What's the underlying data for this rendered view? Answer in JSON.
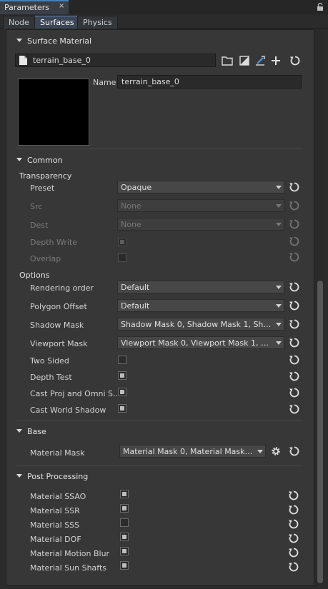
{
  "window": {
    "title": "Parameters",
    "close_glyph": "×"
  },
  "tabs": [
    {
      "label": "Node",
      "active": false
    },
    {
      "label": "Surfaces",
      "active": true
    },
    {
      "label": "Physics",
      "active": false
    }
  ],
  "surface_material": {
    "header": "Surface Material",
    "material_path": "terrain_base_0",
    "name_label": "Name",
    "name_value": "terrain_base_0",
    "toolbar_icons": [
      "folder-icon",
      "inherit-icon",
      "edit-icon",
      "add-icon",
      "reset-icon"
    ]
  },
  "common": {
    "header": "Common",
    "transparency": {
      "label": "Transparency",
      "preset": {
        "label": "Preset",
        "value": "Opaque"
      },
      "src": {
        "label": "Src",
        "value": "None"
      },
      "dest": {
        "label": "Dest",
        "value": "None"
      },
      "depth_write": {
        "label": "Depth Write",
        "checked": true
      },
      "overlap": {
        "label": "Overlap",
        "checked": false
      }
    },
    "options": {
      "label": "Options",
      "rendering_order": {
        "label": "Rendering order",
        "value": "Default"
      },
      "polygon_offset": {
        "label": "Polygon Offset",
        "value": "Default"
      },
      "shadow_mask": {
        "label": "Shadow Mask",
        "value": "Shadow Mask 0, Shadow Mask 1, Shadow ..."
      },
      "viewport_mask": {
        "label": "Viewport Mask",
        "value": "Viewport Mask 0, Viewport Mask 1, Viewpo..."
      },
      "two_sided": {
        "label": "Two Sided",
        "checked": false
      },
      "depth_test": {
        "label": "Depth Test",
        "checked": true
      },
      "cast_proj_omni": {
        "label": "Cast Proj and Omni S...",
        "checked": true
      },
      "cast_world_shadow": {
        "label": "Cast World Shadow",
        "checked": true
      }
    }
  },
  "base": {
    "header": "Base",
    "material_mask": {
      "label": "Material Mask",
      "value": "Material Mask 0, Material Mask 1, Ma..."
    }
  },
  "post_processing": {
    "header": "Post Processing",
    "items": [
      {
        "label": "Material SSAO",
        "checked": true
      },
      {
        "label": "Material SSR",
        "checked": true
      },
      {
        "label": "Material SSS",
        "checked": false
      },
      {
        "label": "Material DOF",
        "checked": true
      },
      {
        "label": "Material Motion Blur",
        "checked": true
      },
      {
        "label": "Material Sun Shafts",
        "checked": true
      }
    ]
  },
  "colors": {
    "accent": "#4a7fb6",
    "panel": "#373737",
    "background": "#2b2b2b"
  }
}
